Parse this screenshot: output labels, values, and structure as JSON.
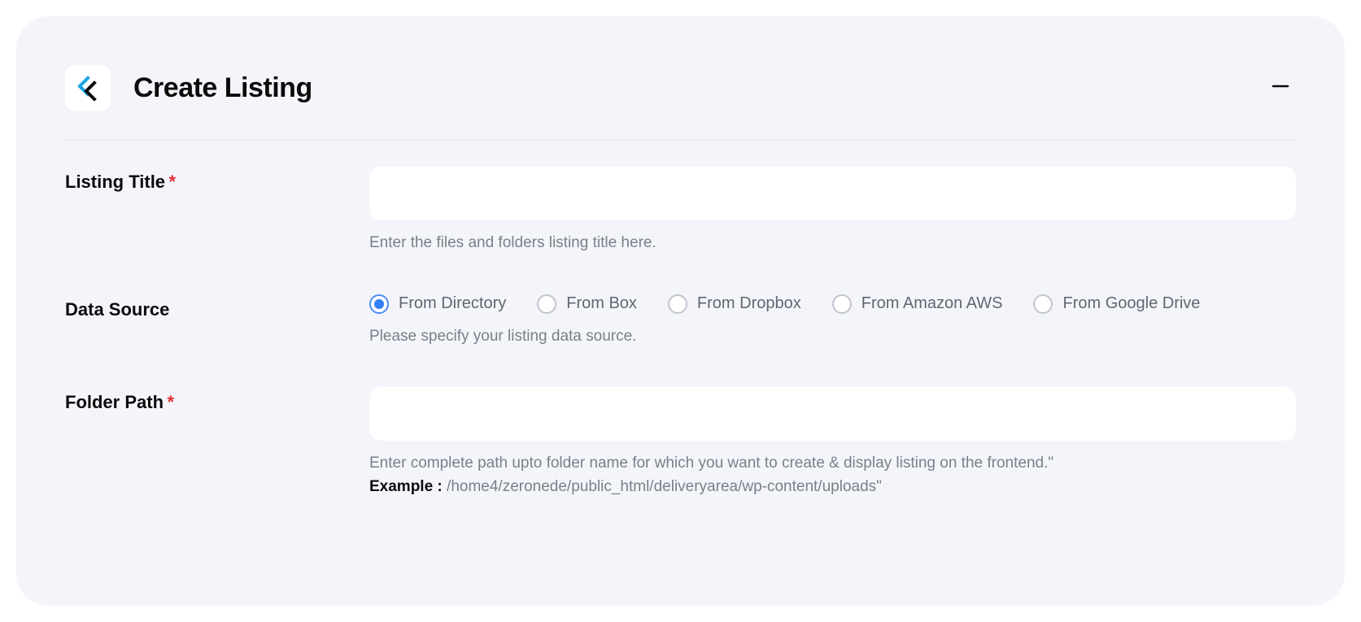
{
  "panel": {
    "title": "Create Listing"
  },
  "form": {
    "listingTitle": {
      "label": "Listing Title",
      "required": "*",
      "value": "",
      "help": "Enter the files and folders listing title here."
    },
    "dataSource": {
      "label": "Data Source",
      "help": "Please specify your listing data source.",
      "options": [
        "From Directory",
        "From Box",
        "From Dropbox",
        "From Amazon AWS",
        "From Google Drive"
      ],
      "selectedIndex": 0
    },
    "folderPath": {
      "label": "Folder Path",
      "required": "*",
      "value": "",
      "help1": "Enter complete path upto folder name for which you want to create & display listing on the frontend.\"",
      "exampleLabel": "Example :",
      "exampleValue": " /home4/zeronede/public_html/deliveryarea/wp-content/uploads\""
    }
  }
}
